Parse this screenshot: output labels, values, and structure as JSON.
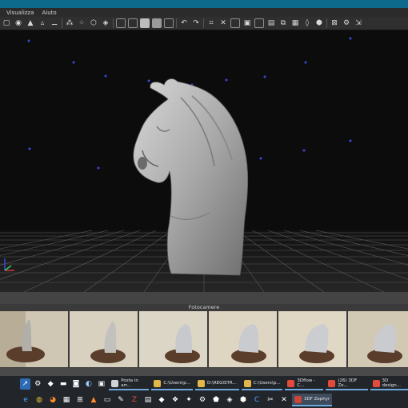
{
  "menubar": {
    "items": [
      "Visualizza",
      "Aiuto"
    ]
  },
  "panel": {
    "cameras_title": "Fotocamere"
  },
  "taskbar": {
    "tasks": [
      {
        "label": "Posta in arr...",
        "color": "#d0d4da"
      },
      {
        "label": "C:\\Users\\p...",
        "color": "#e1b74a"
      },
      {
        "label": "D:\\REGISTR...",
        "color": "#e1b74a"
      },
      {
        "label": "C:\\Users\\p...",
        "color": "#e1b74a"
      },
      {
        "label": "3Dflow - C...",
        "color": "#e24b3b"
      },
      {
        "label": "(26) 3DF Ze...",
        "color": "#e24b3b"
      },
      {
        "label": "3D design...",
        "color": "#e24b3b"
      },
      {
        "label": "3DF Zephyr",
        "color": "#c8463a"
      }
    ]
  },
  "colors": {
    "title_bar": "#0e6a8a",
    "viewport_bg": "#0c0c0c",
    "points": "#3b49d9",
    "grid": "#6a6a6a"
  },
  "icons": {
    "toolbar": [
      "select-icon",
      "move-icon",
      "rotate-icon",
      "scale-icon",
      "brush-icon",
      "lasso-icon",
      "transform-icon",
      "mesh-icon",
      "shield-icon",
      "grid-icon",
      "box-icon",
      "cube-icon",
      "layers-icon",
      "undo-icon",
      "redo-icon",
      "camera-view-icon",
      "crop-icon",
      "fill-icon",
      "point-icon",
      "wire-icon",
      "shade-icon",
      "texture-icon",
      "render-icon",
      "light-icon",
      "measure-icon",
      "hex-icon",
      "settings-icon",
      "export-icon",
      "close-icon"
    ]
  }
}
